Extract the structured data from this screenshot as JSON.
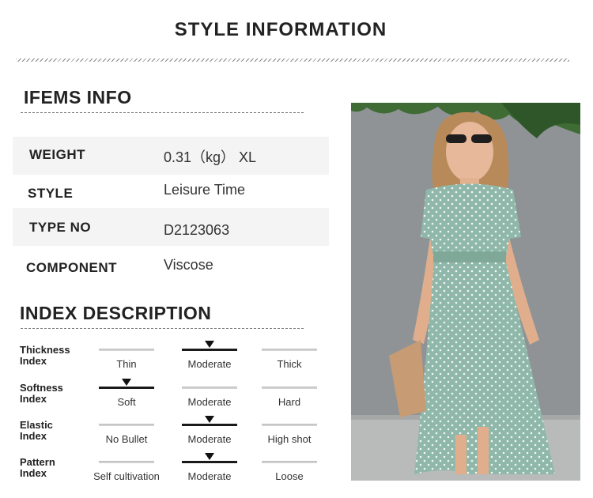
{
  "header": {
    "title": "STYLE INFORMATION"
  },
  "items_info": {
    "heading": "IFEMS INFO",
    "rows": [
      {
        "key": "WEIGHT",
        "value": "0.31（kg） XL"
      },
      {
        "key": "STYLE",
        "value": "Leisure Time"
      },
      {
        "key": "TYPE NO",
        "value": "D2123063"
      },
      {
        "key": "COMPONENT",
        "value": "Viscose"
      }
    ]
  },
  "index_description": {
    "heading": "INDEX DESCRIPTION",
    "indices": [
      {
        "label_line1": "Thickness",
        "label_line2": "Index",
        "options": [
          "Thin",
          "Moderate",
          "Thick"
        ],
        "selected": 1
      },
      {
        "label_line1": "Softness",
        "label_line2": "Index",
        "options": [
          "Soft",
          "Moderate",
          "Hard"
        ],
        "selected": 0
      },
      {
        "label_line1": "Elastic",
        "label_line2": "Index",
        "options": [
          "No Bullet",
          "Moderate",
          "High shot"
        ],
        "selected": 1
      },
      {
        "label_line1": "Pattern",
        "label_line2": "Index",
        "options": [
          "Self cultivation",
          "Moderate",
          "Loose"
        ],
        "selected": 1
      }
    ]
  },
  "colors": {
    "dress": "#8fb8aa",
    "wall": "#8f9396",
    "leaves": "#3f6b34"
  }
}
